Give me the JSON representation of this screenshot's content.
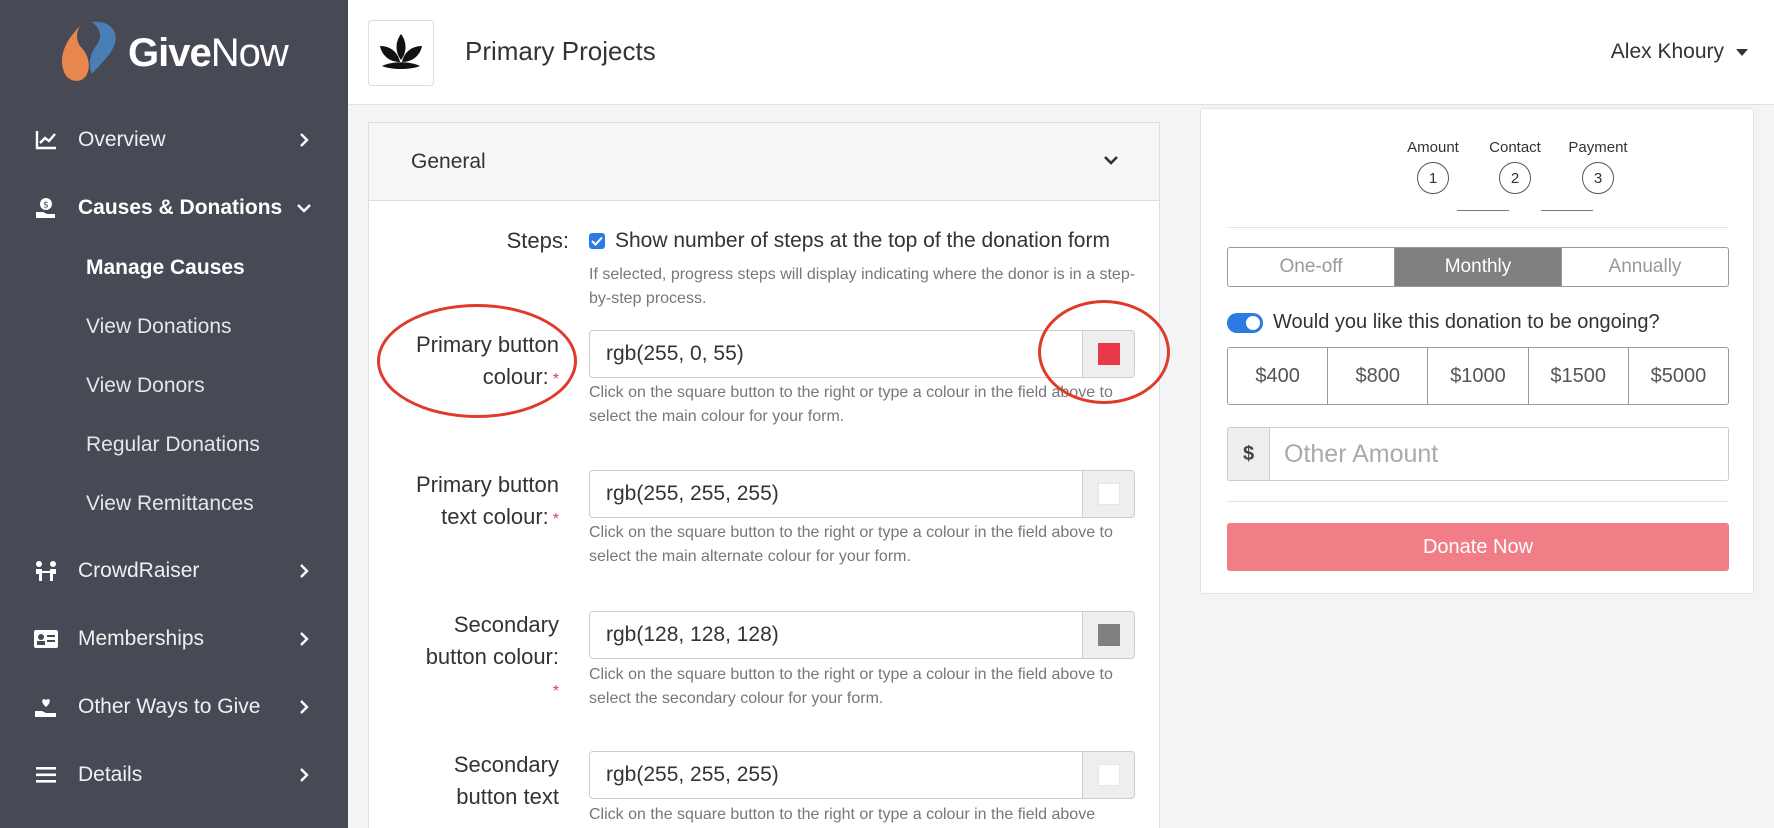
{
  "brand": {
    "name_bold": "Give",
    "name_light": "Now",
    "accent_orange": "#e7874f",
    "accent_blue": "#4a7fb5"
  },
  "sidebar": {
    "items": [
      {
        "label": "Overview",
        "icon": "line-chart-icon"
      },
      {
        "label": "Causes & Donations",
        "icon": "donation-hand-icon"
      },
      {
        "label": "CrowdRaiser",
        "icon": "people-icon"
      },
      {
        "label": "Memberships",
        "icon": "id-card-icon"
      },
      {
        "label": "Other Ways to Give",
        "icon": "hand-heart-icon"
      },
      {
        "label": "Details",
        "icon": "list-icon"
      }
    ],
    "subitems": [
      "Manage Causes",
      "View Donations",
      "View Donors",
      "Regular Donations",
      "View Remittances"
    ]
  },
  "header": {
    "org_name": "Primary Projects",
    "user_name": "Alex Khoury"
  },
  "form": {
    "section_title": "General",
    "steps_label": "Steps:",
    "steps_checkbox_label": "Show number of steps at the top of the donation form",
    "steps_checked": true,
    "steps_help": "If selected, progress steps will display indicating where the donor is in a step-by-step process.",
    "fields": [
      {
        "label_line1": "Primary button",
        "label_line2": "colour:",
        "value": "rgb(255, 0, 55)",
        "swatch": "#e8394a",
        "help": "Click on the square button to the right or type a colour in the field above to select the main colour for your form."
      },
      {
        "label_line1": "Primary button",
        "label_line2": "text colour:",
        "value": "rgb(255, 255, 255)",
        "swatch": "#ffffff",
        "help": "Click on the square button to the right or type a colour in the field above to select the main alternate colour for your form."
      },
      {
        "label_line1": "Secondary",
        "label_line2": "button colour:",
        "value": "rgb(128, 128, 128)",
        "swatch": "#808080",
        "help": "Click on the square button to the right or type a colour in the field above to select the secondary colour for your form."
      },
      {
        "label_line1": "Secondary",
        "label_line2": "button text",
        "value": "rgb(255, 255, 255)",
        "swatch": "#ffffff",
        "help": "Click on the square button to the right or type a colour in the field above"
      }
    ],
    "required_mark": "*"
  },
  "preview": {
    "steps": [
      {
        "label": "Amount",
        "num": "1"
      },
      {
        "label": "Contact",
        "num": "2"
      },
      {
        "label": "Payment",
        "num": "3"
      }
    ],
    "frequency": [
      "One-off",
      "Monthly",
      "Annually"
    ],
    "frequency_selected": "Monthly",
    "ongoing_question": "Would you like this donation to be ongoing?",
    "amounts": [
      "$400",
      "$800",
      "$1000",
      "$1500",
      "$5000"
    ],
    "currency_symbol": "$",
    "other_amount_placeholder": "Other Amount",
    "donate_label": "Donate Now",
    "donate_color": "#f17d86"
  }
}
